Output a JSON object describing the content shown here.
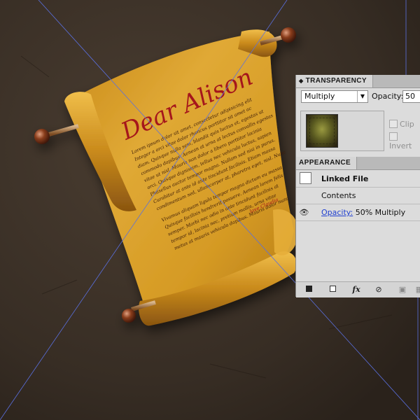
{
  "colors": {
    "background": "#3a3026",
    "parchment": "#d39a22",
    "ink": "#3a1a08",
    "accent_red": "#a5141a",
    "guide_line": "#5a70e0",
    "panel_bg": "#dcdcdc"
  },
  "artwork": {
    "heading": "Dear Alison",
    "body_lines": [
      "Lorem ipsum dolor sit amet, consectetur adipisicing elit",
      "Integer a orci vitae dolor rhoncus porttitor sit amet ac",
      "diam. Quisque nulla sem, blandit quis luctus et, egestas ut",
      "commodo dapibus. Aenean at urna at lectus convallis egestas",
      "vitae ut nisl. Mauris non dolor a libero porttitor lacinia",
      "orci. Quisque dignissim, tellus nec vehicula luctus, sapien",
      "Phasellus auctor tempor magna. Nullam sed nisi in purus.",
      "Curabitur at ante id ante tincidunt facilisis. Etiam massa",
      "condimentum sed, ullamcorper at, pharetra eget, nisl. Nunc"
    ],
    "body_lines_b": [
      "Vivamus aliquam ligula tempor magna dictum eu massa",
      "Quisque facilisis hendrerit posuere. Aenean lorem felis",
      "semper. Morbi nec odio in ante tincidunt facilisis at",
      "tempor id, lacinia nec, pretium mollis, urna vitae",
      "metus at mauris vehicula dapibus. Mauris dolor nunc"
    ],
    "signature": "love Claudia"
  },
  "transparency": {
    "title": "TRANSPARENCY",
    "blend_mode": "Multiply",
    "opacity_label": "Opacity:",
    "opacity_value": "50",
    "clip_label": "Clip",
    "invert_label": "Invert"
  },
  "appearance": {
    "title": "APPEARANCE",
    "linked_file": "Linked File",
    "contents": "Contents",
    "opacity_link": "Opacity:",
    "opacity_value": "50% Multiply"
  },
  "icons": {
    "panel_grip": "grip-icon",
    "dropdown": "chevron-down-icon",
    "eye": "eye-icon",
    "new_stroke": "new-stroke-icon",
    "new_fill": "new-fill-icon",
    "fx": "fx-icon",
    "clear": "clear-appearance-icon",
    "duplicate": "duplicate-item-icon",
    "delete": "trash-icon"
  }
}
